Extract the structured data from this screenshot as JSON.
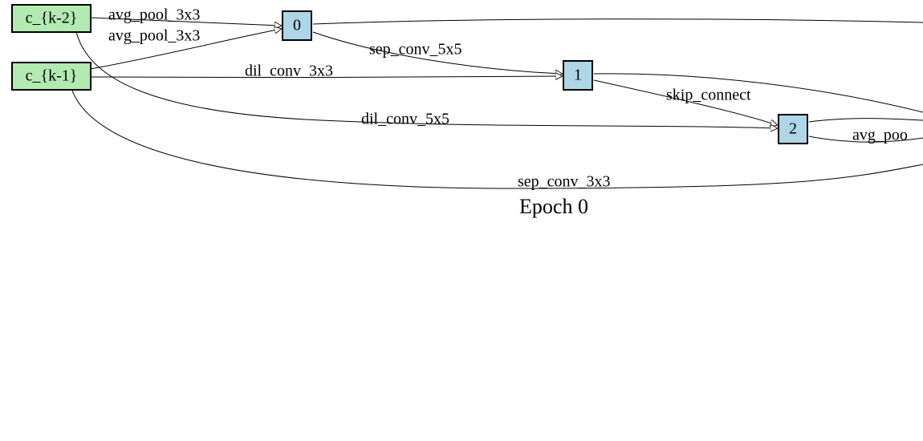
{
  "caption": "Epoch 0",
  "nodes": {
    "ckm2": {
      "label": "c_{k-2}"
    },
    "ckm1": {
      "label": "c_{k-1}"
    },
    "n0": {
      "label": "0"
    },
    "n1": {
      "label": "1"
    },
    "n2": {
      "label": "2"
    }
  },
  "edges": {
    "ckm2_to_n0": {
      "label": "avg_pool_3x3"
    },
    "ckm1_to_n0": {
      "label": "avg_pool_3x3"
    },
    "n0_to_n1": {
      "label": "sep_conv_5x5"
    },
    "ckm1_to_n1": {
      "label": "dil_conv_3x3"
    },
    "n1_to_n2": {
      "label": "skip_connect"
    },
    "ckm2_to_n2": {
      "label": "dil_conv_5x5"
    },
    "n2_to_out": {
      "label": "avg_poo"
    },
    "ckm1_to_out": {
      "label": "sep_conv_3x3"
    }
  }
}
